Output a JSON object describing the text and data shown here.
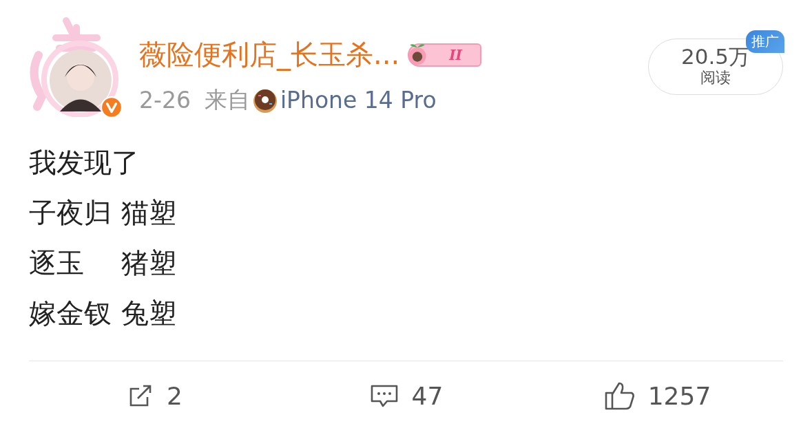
{
  "post": {
    "author": {
      "name": "薇险便利店_长玉杀...",
      "verified": true,
      "level_badge": "II"
    },
    "date": "2-26",
    "source_prefix": "来自",
    "device": "iPhone 14 Pro",
    "reads": {
      "count": "20.5万",
      "label": "阅读",
      "promo_badge": "推广"
    },
    "intro": "我发现了",
    "rows": [
      {
        "title": "子夜归",
        "figure": "猫塑"
      },
      {
        "title": "逐玉",
        "figure": "猪塑"
      },
      {
        "title": "嫁金钗",
        "figure": "兔塑"
      }
    ],
    "actions": [
      {
        "kind": "repost",
        "count": "2"
      },
      {
        "kind": "comment",
        "count": "47"
      },
      {
        "kind": "like",
        "count": "1257"
      }
    ]
  }
}
